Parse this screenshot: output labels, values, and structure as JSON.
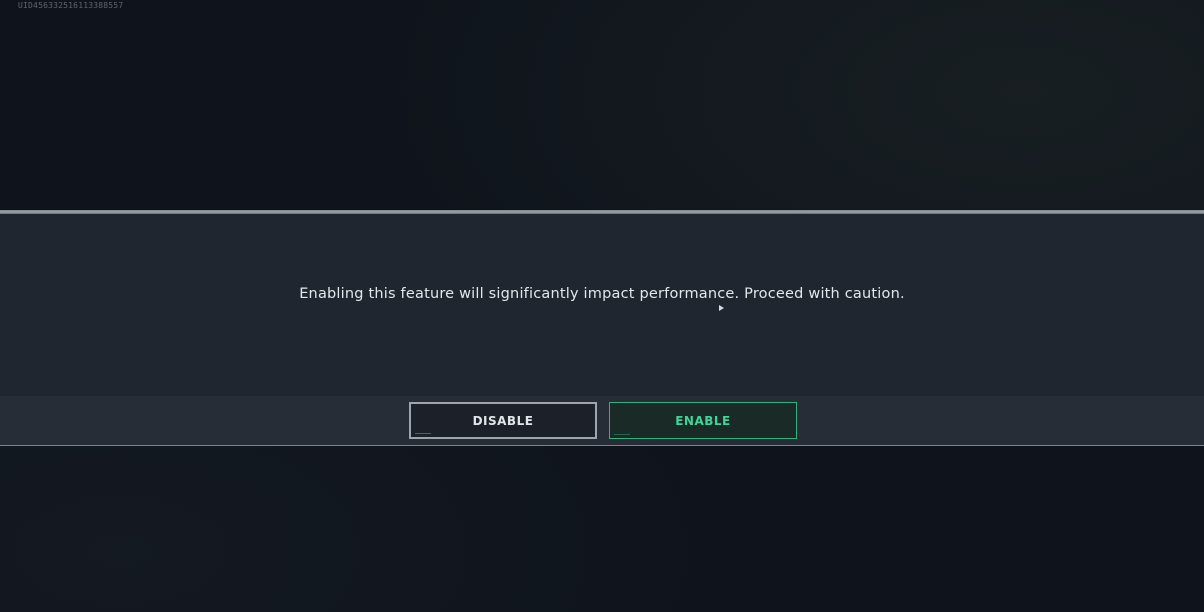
{
  "uid_label": "UID456332516113388557",
  "dialog": {
    "message": "Enabling this feature will significantly impact performance. Proceed with caution.",
    "buttons": {
      "disable_label": "DISABLE",
      "enable_label": "ENABLE"
    }
  },
  "colors": {
    "background": "#0f141c",
    "modal": "#1f2630",
    "footer": "#262d37",
    "enable_accent": "#3fd597"
  }
}
